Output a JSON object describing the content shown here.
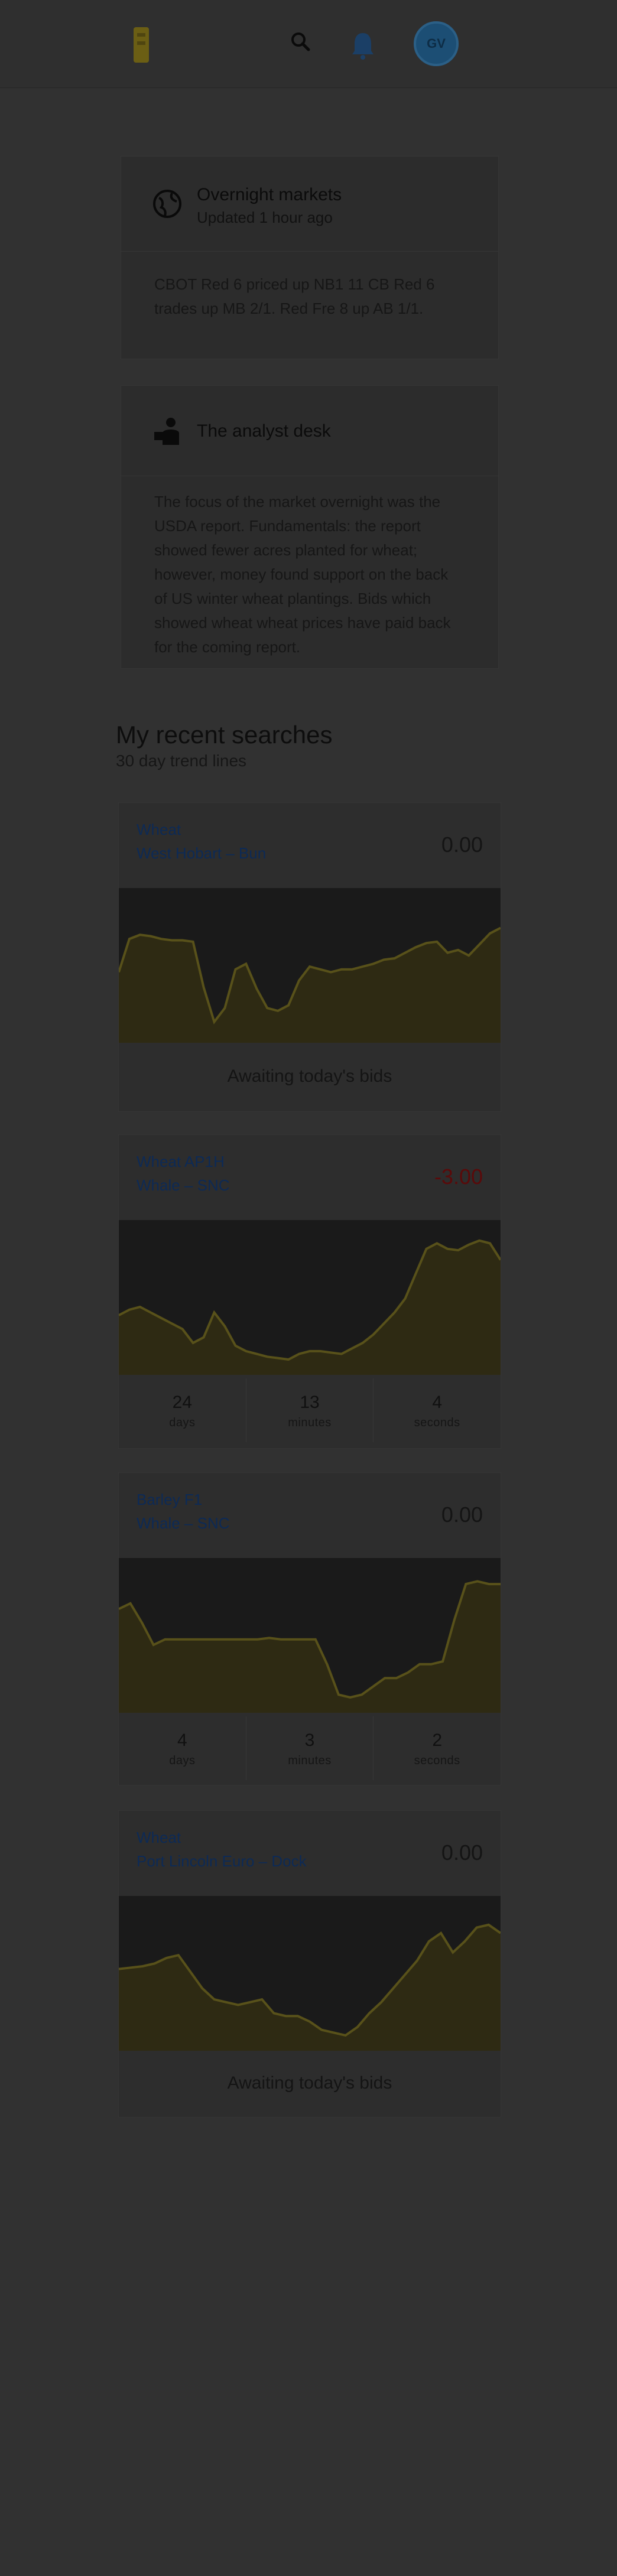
{
  "header": {
    "avatar_initials": "GV",
    "colors": {
      "logo": "#6b5e14",
      "bell": "#1b3f66",
      "avatar": "#1c4e74"
    },
    "icons": [
      "logo-icon",
      "search-icon",
      "bell-icon",
      "avatar"
    ]
  },
  "cards": [
    {
      "icon": "globe-icon",
      "title": "Overnight markets",
      "subtitle": "Updated 1 hour ago",
      "body": "CBOT Red 6 priced up NB1 11 CB Red 6 trades up MB 2/1. Red Fre 8 up AB 1/1."
    },
    {
      "icon": "analyst-icon",
      "title": "The analyst desk",
      "body": "The focus of the market overnight was the USDA report. Fundamentals: the report showed fewer acres planted for wheat; however, money found support on the back of US winter wheat plantings. Bids which showed wheat wheat prices have paid back for the coming report."
    }
  ],
  "searches": {
    "title": "My recent searches",
    "subtitle": "30 day trend lines",
    "items": [
      {
        "name": "Wheat",
        "location": "West Hobart – Bun",
        "value": "0.00",
        "negative": false,
        "footer": "Awaiting today's bids",
        "trend": [
          46,
          70,
          73,
          72,
          70,
          69,
          69,
          68,
          35,
          10,
          20,
          48,
          52,
          34,
          20,
          18,
          22,
          40,
          50,
          48,
          46,
          48,
          48,
          50,
          52,
          55,
          56,
          60,
          64,
          67,
          68,
          60,
          62,
          58,
          66,
          74,
          78
        ]
      },
      {
        "name": "Wheat AP1H",
        "location": "Whale – SNC",
        "value": "-3.00",
        "negative": true,
        "stats": [
          {
            "num": "24",
            "label": "days"
          },
          {
            "num": "13",
            "label": "minutes"
          },
          {
            "num": "4",
            "label": "seconds"
          }
        ],
        "trend": [
          38,
          42,
          44,
          40,
          36,
          32,
          28,
          18,
          22,
          40,
          30,
          16,
          12,
          10,
          8,
          7,
          6,
          10,
          12,
          12,
          11,
          10,
          14,
          18,
          24,
          32,
          40,
          50,
          68,
          86,
          90,
          86,
          85,
          89,
          92,
          90,
          78
        ]
      },
      {
        "name": "Barley F1",
        "location": "Whale – SNC",
        "value": "0.00",
        "negative": false,
        "stats": [
          {
            "num": "4",
            "label": "days"
          },
          {
            "num": "3",
            "label": "minutes"
          },
          {
            "num": "2",
            "label": "seconds"
          }
        ],
        "trend": [
          70,
          74,
          60,
          44,
          48,
          48,
          48,
          48,
          48,
          48,
          48,
          48,
          48,
          49,
          48,
          48,
          48,
          48,
          30,
          8,
          6,
          8,
          14,
          20,
          20,
          24,
          30,
          30,
          32,
          62,
          88,
          90,
          88,
          88
        ]
      },
      {
        "name": "Wheat",
        "location": "Port Lincoln Euro – Dock",
        "value": "0.00",
        "negative": false,
        "footer": "Awaiting today's bids",
        "trend": [
          54,
          55,
          56,
          58,
          62,
          64,
          52,
          40,
          32,
          30,
          28,
          30,
          32,
          22,
          20,
          20,
          16,
          10,
          8,
          6,
          12,
          22,
          30,
          40,
          50,
          60,
          74,
          80,
          66,
          74,
          84,
          86,
          80
        ]
      }
    ]
  }
}
